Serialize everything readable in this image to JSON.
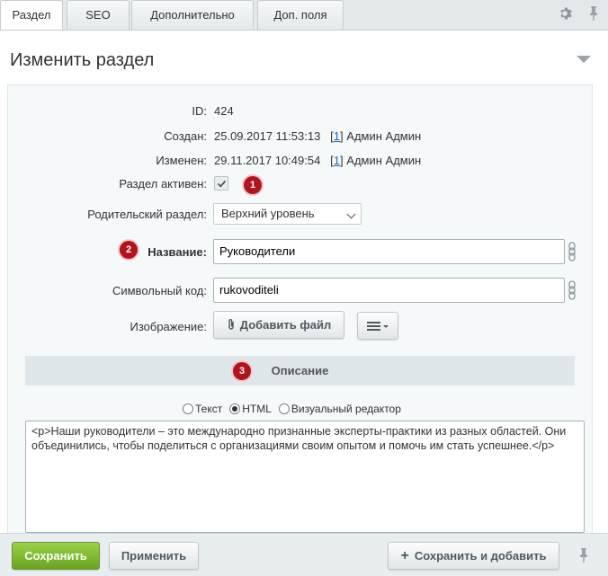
{
  "tabs": [
    {
      "label": "Раздел",
      "active": true
    },
    {
      "label": "SEO",
      "active": false
    },
    {
      "label": "Дополнительно",
      "active": false
    },
    {
      "label": "Доп. поля",
      "active": false
    }
  ],
  "header": {
    "title": "Изменить раздел"
  },
  "form": {
    "id_label": "ID:",
    "id_value": "424",
    "created_label": "Создан:",
    "created_value": "25.09.2017 11:53:13",
    "created_user_prefix": "[",
    "created_user_id": "1",
    "created_user_suffix": "]",
    "created_user_name": "Админ Админ",
    "modified_label": "Изменен:",
    "modified_value": "29.11.2017 10:49:54",
    "modified_user_prefix": "[",
    "modified_user_id": "1",
    "modified_user_suffix": "]",
    "modified_user_name": "Админ Админ",
    "active_label": "Раздел активен:",
    "active_checked": true,
    "parent_label": "Родительский раздел:",
    "parent_value": "Верхний уровень",
    "name_label": "Название:",
    "name_value": "Руководители",
    "code_label": "Символьный код:",
    "code_value": "rukovoditeli",
    "image_label": "Изображение:",
    "add_file_label": "Добавить файл"
  },
  "description": {
    "heading": "Описание",
    "modes": [
      {
        "label": "Текст",
        "selected": false
      },
      {
        "label": "HTML",
        "selected": true
      },
      {
        "label": "Визуальный редактор",
        "selected": false
      }
    ],
    "content": "<p>Наши руководители – это международно признанные эксперты-практики из разных областей. Они объединились, чтобы поделиться с организациями своим опытом и помочь им стать успешнее.</p>"
  },
  "badges": [
    "1",
    "2",
    "3"
  ],
  "buttons": {
    "save": "Сохранить",
    "apply": "Применить",
    "save_add": "Сохранить и добавить"
  },
  "colors": {
    "accent_red": "#b0151d",
    "save_green": "#7cb82f",
    "link_blue": "#2067b0"
  }
}
